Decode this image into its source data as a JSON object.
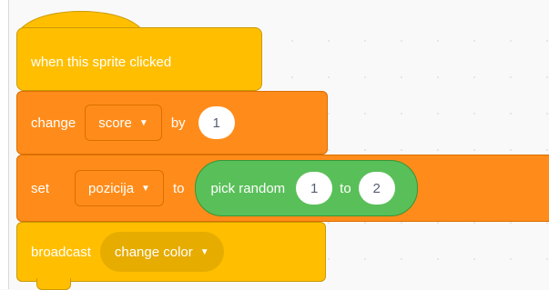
{
  "hat_block": {
    "label": "when this sprite clicked"
  },
  "change_block": {
    "verb": "change",
    "variable": "score",
    "by_label": "by",
    "value": "1"
  },
  "set_block": {
    "verb": "set",
    "variable": "pozicija",
    "to_label": "to",
    "reporter": {
      "label": "pick random",
      "from": "1",
      "to_label": "to",
      "to": "2"
    }
  },
  "broadcast_block": {
    "verb": "broadcast",
    "message": "change color"
  },
  "colors": {
    "events": "#ffbf00",
    "variables": "#ff8c1a",
    "operators": "#59c059",
    "canvas": "#f9f9f9"
  },
  "icons": {
    "dropdown": "caret-down-icon"
  }
}
